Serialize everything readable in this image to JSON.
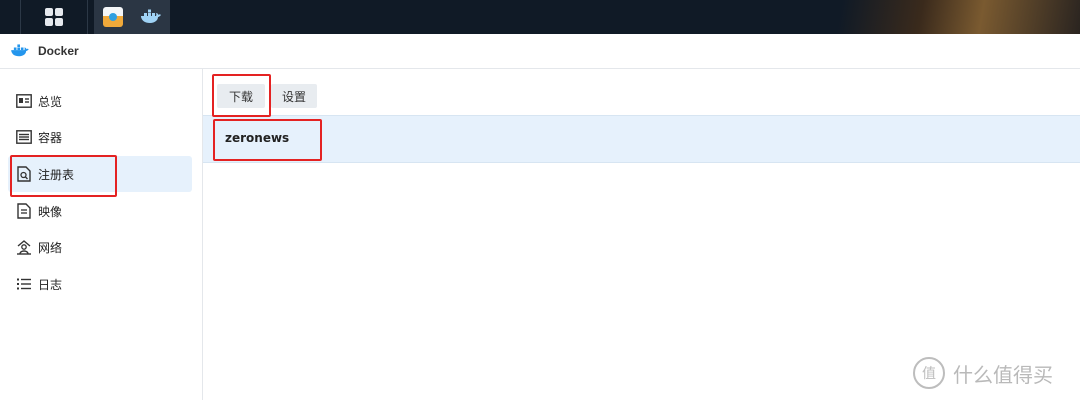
{
  "taskbar": {
    "main_menu_icon": "grid-icon",
    "apps": [
      "package-center-icon",
      "docker-icon"
    ]
  },
  "window": {
    "title": "Docker",
    "title_icon": "docker-whale-icon"
  },
  "sidebar": {
    "items": [
      {
        "label": "总览",
        "icon": "overview-icon",
        "active": false
      },
      {
        "label": "容器",
        "icon": "container-icon",
        "active": false
      },
      {
        "label": "注册表",
        "icon": "registry-search-icon",
        "active": true
      },
      {
        "label": "映像",
        "icon": "image-icon",
        "active": false
      },
      {
        "label": "网络",
        "icon": "network-icon",
        "active": false
      },
      {
        "label": "日志",
        "icon": "log-list-icon",
        "active": false
      }
    ]
  },
  "toolbar": {
    "download_label": "下载",
    "settings_label": "设置"
  },
  "registry": {
    "rows": [
      {
        "name": "zeronews",
        "selected": true
      }
    ]
  },
  "watermark": {
    "text": "什么值得买",
    "logo_char": "值"
  },
  "colors": {
    "highlight": "#e42222",
    "selection": "#e6f1fc",
    "taskbar": "#101a26"
  }
}
